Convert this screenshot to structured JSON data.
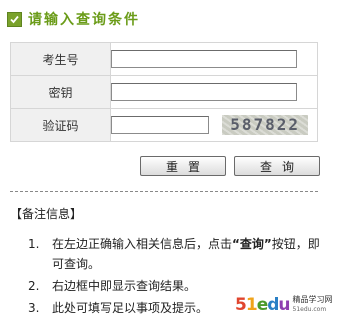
{
  "header": {
    "title": "请输入查询条件",
    "icon": "check-icon",
    "accent": "#6b9c19"
  },
  "form": {
    "rows": [
      {
        "label": "考生号",
        "value": ""
      },
      {
        "label": "密钥",
        "value": ""
      },
      {
        "label": "验证码",
        "value": ""
      }
    ],
    "captcha": "587822"
  },
  "buttons": {
    "reset": "重置",
    "query": "查询"
  },
  "notes": {
    "title": "【备注信息】",
    "items": [
      {
        "num": "1.",
        "before": "在左边正确输入相关信息后，点击",
        "highlight": "“查询”",
        "after": "按钮，即可查询。"
      },
      {
        "num": "2.",
        "text": "右边框中即显示查询结果。"
      },
      {
        "num": "3.",
        "text": "此处可填写足以事项及提示。"
      }
    ]
  },
  "watermark": {
    "logo_parts": [
      "5",
      "1",
      "e",
      "d",
      "u"
    ],
    "cn": "精品学习网",
    "domain": "51edu.com"
  }
}
